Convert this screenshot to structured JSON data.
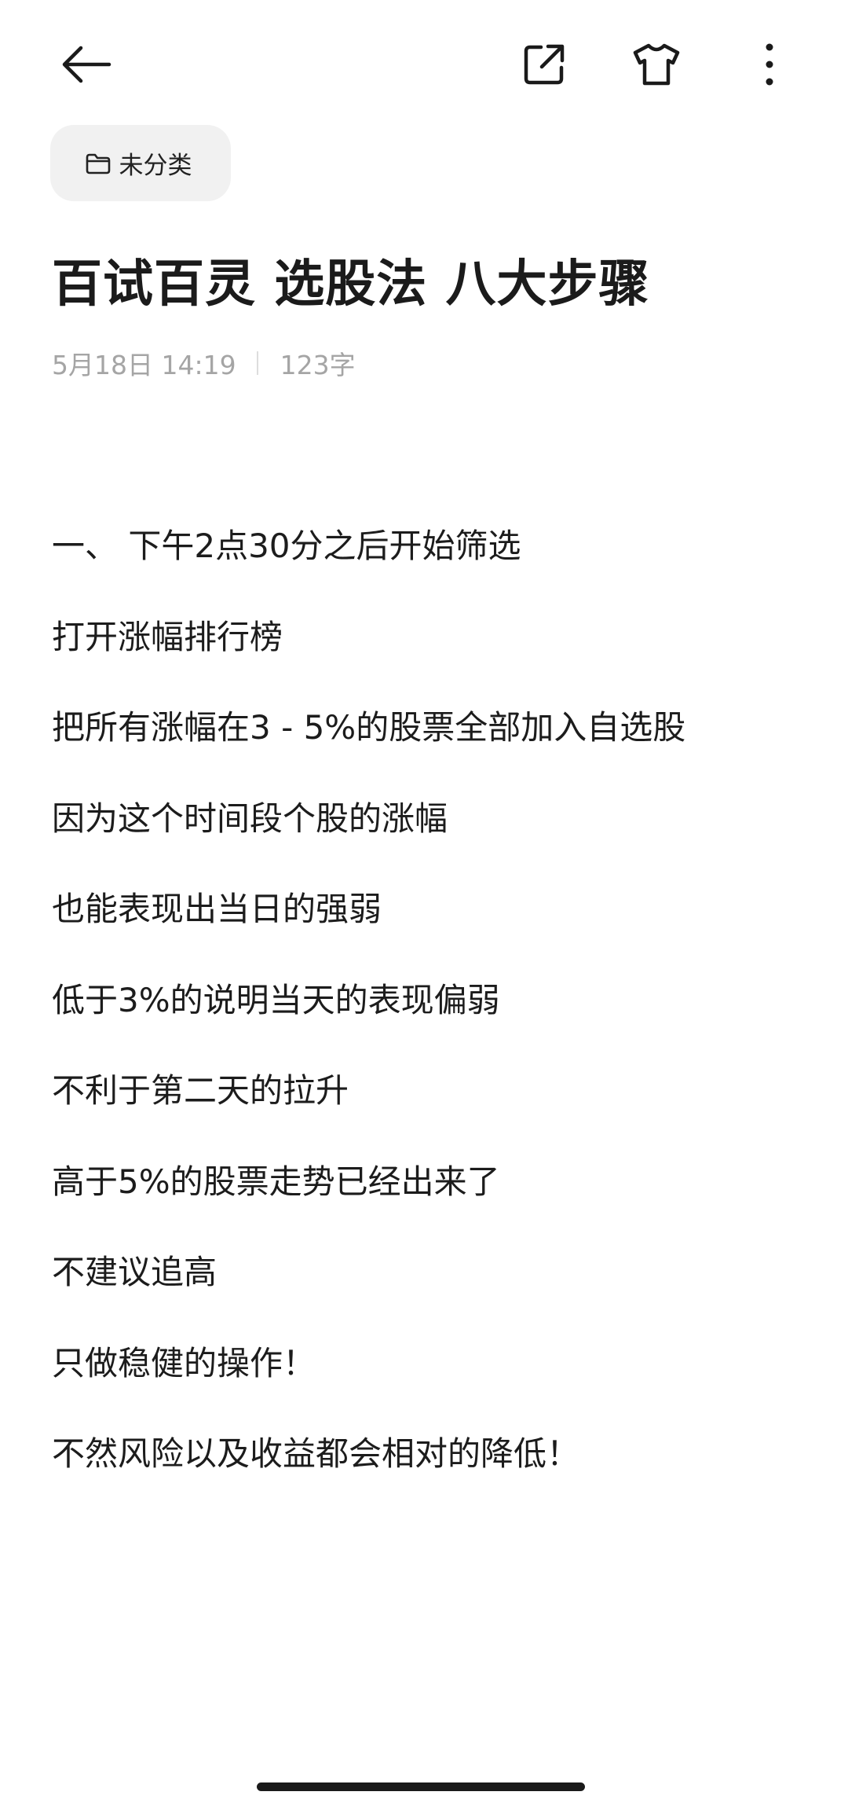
{
  "toolbar": {
    "back_icon": "back-arrow-icon",
    "share_icon": "share-icon",
    "theme_icon": "tshirt-icon",
    "more_icon": "more-vertical-icon"
  },
  "folder": {
    "icon": "folder-icon",
    "label": "未分类"
  },
  "note": {
    "title": "百试百灵 选股法 八大步骤",
    "date": "5月18日 14:19",
    "word_count": "123字",
    "lines": [
      "一、 下午2点30分之后开始筛选",
      "打开涨幅排行榜",
      "把所有涨幅在3 - 5%的股票全部加入自选股",
      "因为这个时间段个股的涨幅",
      "也能表现出当日的强弱",
      "低于3%的说明当天的表现偏弱",
      "不利于第二天的拉升",
      "高于5%的股票走势已经出来了",
      "不建议追高",
      "只做稳健的操作！",
      "不然风险以及收益都会相对的降低！"
    ]
  },
  "colors": {
    "text": "#1c1c1c",
    "meta": "#a5a5a5",
    "chip_bg": "#f1f1f1",
    "background": "#ffffff"
  }
}
